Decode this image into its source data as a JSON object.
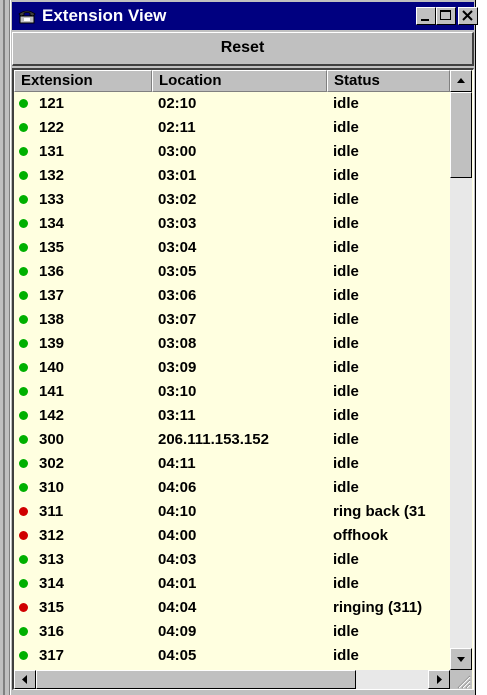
{
  "window": {
    "title": "Extension View",
    "icon": "telephone-icon",
    "controls": {
      "minimize": "_",
      "maximize": "□",
      "close": "✕"
    }
  },
  "toolbar": {
    "reset_label": "Reset"
  },
  "table": {
    "columns": [
      "Extension",
      "Location",
      "Status"
    ],
    "rows": [
      {
        "ext": "121",
        "location": "02:10",
        "status": "idle",
        "indicator": "green"
      },
      {
        "ext": "122",
        "location": "02:11",
        "status": "idle",
        "indicator": "green"
      },
      {
        "ext": "131",
        "location": "03:00",
        "status": "idle",
        "indicator": "green"
      },
      {
        "ext": "132",
        "location": "03:01",
        "status": "idle",
        "indicator": "green"
      },
      {
        "ext": "133",
        "location": "03:02",
        "status": "idle",
        "indicator": "green"
      },
      {
        "ext": "134",
        "location": "03:03",
        "status": "idle",
        "indicator": "green"
      },
      {
        "ext": "135",
        "location": "03:04",
        "status": "idle",
        "indicator": "green"
      },
      {
        "ext": "136",
        "location": "03:05",
        "status": "idle",
        "indicator": "green"
      },
      {
        "ext": "137",
        "location": "03:06",
        "status": "idle",
        "indicator": "green"
      },
      {
        "ext": "138",
        "location": "03:07",
        "status": "idle",
        "indicator": "green"
      },
      {
        "ext": "139",
        "location": "03:08",
        "status": "idle",
        "indicator": "green"
      },
      {
        "ext": "140",
        "location": "03:09",
        "status": "idle",
        "indicator": "green"
      },
      {
        "ext": "141",
        "location": "03:10",
        "status": "idle",
        "indicator": "green"
      },
      {
        "ext": "142",
        "location": "03:11",
        "status": "idle",
        "indicator": "green"
      },
      {
        "ext": "300",
        "location": "206.111.153.152",
        "status": "idle",
        "indicator": "green"
      },
      {
        "ext": "302",
        "location": "04:11",
        "status": "idle",
        "indicator": "green"
      },
      {
        "ext": "310",
        "location": "04:06",
        "status": "idle",
        "indicator": "green"
      },
      {
        "ext": "311",
        "location": "04:10",
        "status": "ring back (31",
        "indicator": "red"
      },
      {
        "ext": "312",
        "location": "04:00",
        "status": "offhook",
        "indicator": "red"
      },
      {
        "ext": "313",
        "location": "04:03",
        "status": "idle",
        "indicator": "green"
      },
      {
        "ext": "314",
        "location": "04:01",
        "status": "idle",
        "indicator": "green"
      },
      {
        "ext": "315",
        "location": "04:04",
        "status": "ringing (311)",
        "indicator": "red"
      },
      {
        "ext": "316",
        "location": "04:09",
        "status": "idle",
        "indicator": "green"
      },
      {
        "ext": "317",
        "location": "04:05",
        "status": "idle",
        "indicator": "green"
      }
    ]
  },
  "colors": {
    "titlebar": "#000080",
    "list_background": "#ffffe0",
    "green_indicator": "#00b000",
    "red_indicator": "#d00000"
  }
}
